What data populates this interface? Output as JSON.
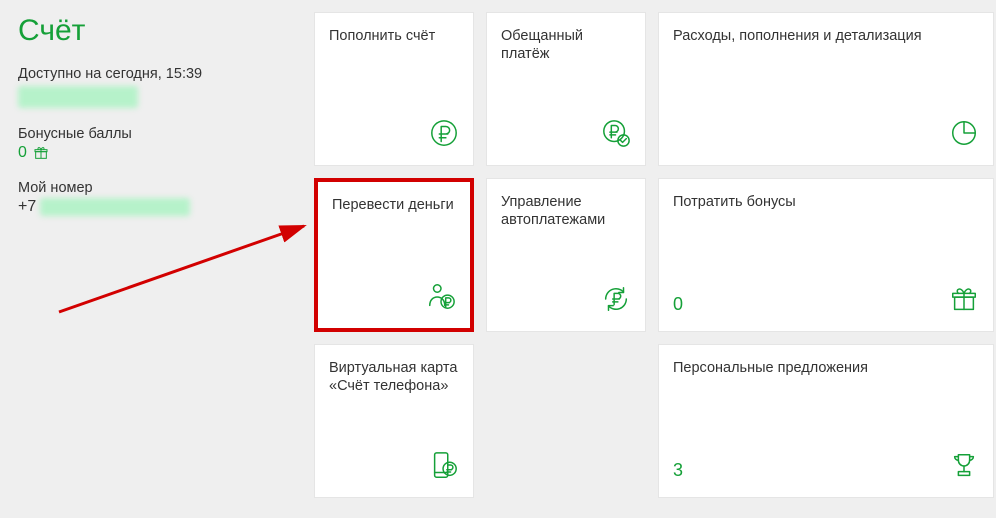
{
  "colors": {
    "accent": "#15a038",
    "highlight": "#d20000"
  },
  "sidebar": {
    "title": "Счёт",
    "available_label": "Доступно на сегодня, 15:39",
    "bonus_label": "Бонусные баллы",
    "bonus_value": "0",
    "phone_label": "Мой номер",
    "phone_prefix": "+7"
  },
  "cards": {
    "topup": "Пополнить счёт",
    "promised": "Обещанный платёж",
    "expenses": "Расходы, пополнения и детализация",
    "transfer": "Перевести деньги",
    "autopay": "Управление автоплатежами",
    "spendbonus": "Потратить бонусы",
    "spendbonus_value": "0",
    "virtcard": "Виртуальная карта «Счёт телефона»",
    "offers": "Персональные предложения",
    "offers_value": "3"
  }
}
